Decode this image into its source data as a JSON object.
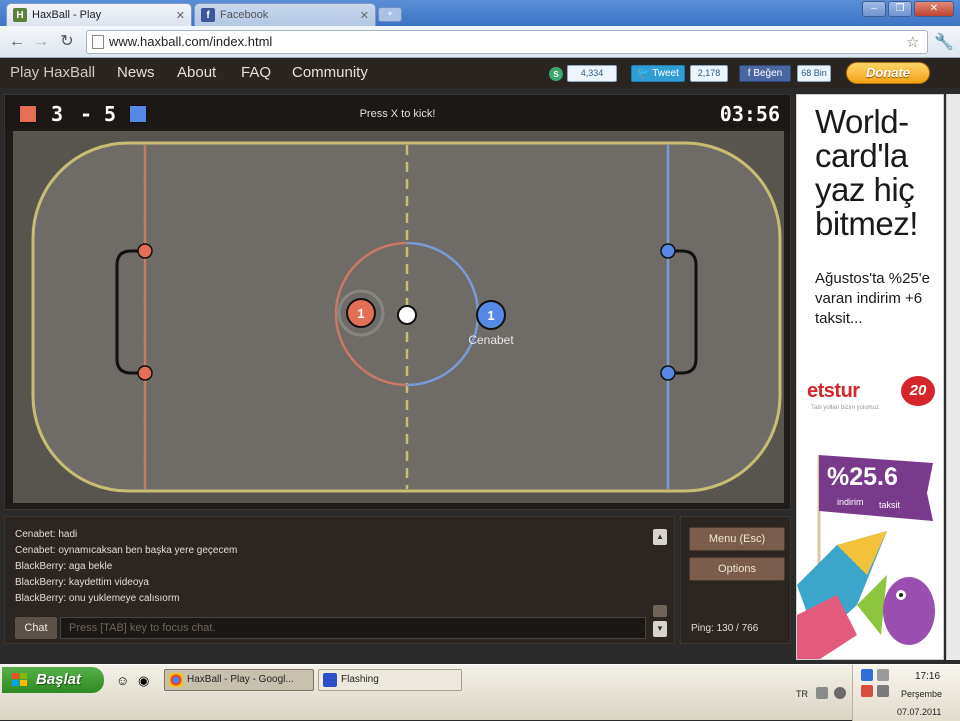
{
  "browser": {
    "tabs": [
      {
        "title": "HaxBall - Play",
        "icon": "H"
      },
      {
        "title": "Facebook",
        "icon": "f"
      }
    ],
    "new_tab": "+",
    "url": "www.haxball.com/index.html"
  },
  "site": {
    "nav": [
      "Play HaxBall",
      "News",
      "About",
      "FAQ",
      "Community"
    ],
    "share_count": "4,334",
    "tweet_label": "Tweet",
    "tweet_count": "2,178",
    "like_label": "Beğen",
    "like_count": "68 Bin",
    "donate_label": "Donate"
  },
  "game": {
    "red_score": "3",
    "score_separator": "-",
    "blue_score": "5",
    "hint": "Press X to kick!",
    "timer": "03:56",
    "red_player_number": "1",
    "blue_player_number": "1",
    "blue_player_name": "Cenabet",
    "colors": {
      "red": "#e56e56",
      "blue": "#5689e5",
      "pitch": "#6f6c68",
      "line": "#c7bd73",
      "red_line": "#c77a66",
      "blue_line": "#7a9bd6"
    }
  },
  "ad": {
    "headline": "World-card'la yaz hiç bitmez!",
    "subtext": "Ağustos'ta %25'e varan indirim +6 taksit...",
    "brand": "etstur",
    "brand_badge": "20",
    "tagline": "Tatil yolları bizim yolumuz",
    "promo_rate": "%25.6",
    "promo_label1": "indirim",
    "promo_label2": "taksit"
  },
  "chat": {
    "messages": [
      "Cenabet: hadi",
      "Cenabet: oynamıcaksan ben başka yere geçecem",
      "BlackBerry: aga bekle",
      "BlackBerry: kaydettim videoya",
      "BlackBerry: onu yuklemeye calısıorm"
    ],
    "label": "Chat",
    "placeholder": "Press [TAB] key to focus chat."
  },
  "menu": {
    "menu_label": "Menu (Esc)",
    "options_label": "Options",
    "ping": "Ping: 130 / 766"
  },
  "taskbar": {
    "start_label": "Başlat",
    "items": [
      "HaxBall - Play - Googl...",
      "Flashing"
    ],
    "language": "TR",
    "time": "17:16",
    "day": "Perşembe",
    "date": "07.07.2011"
  }
}
